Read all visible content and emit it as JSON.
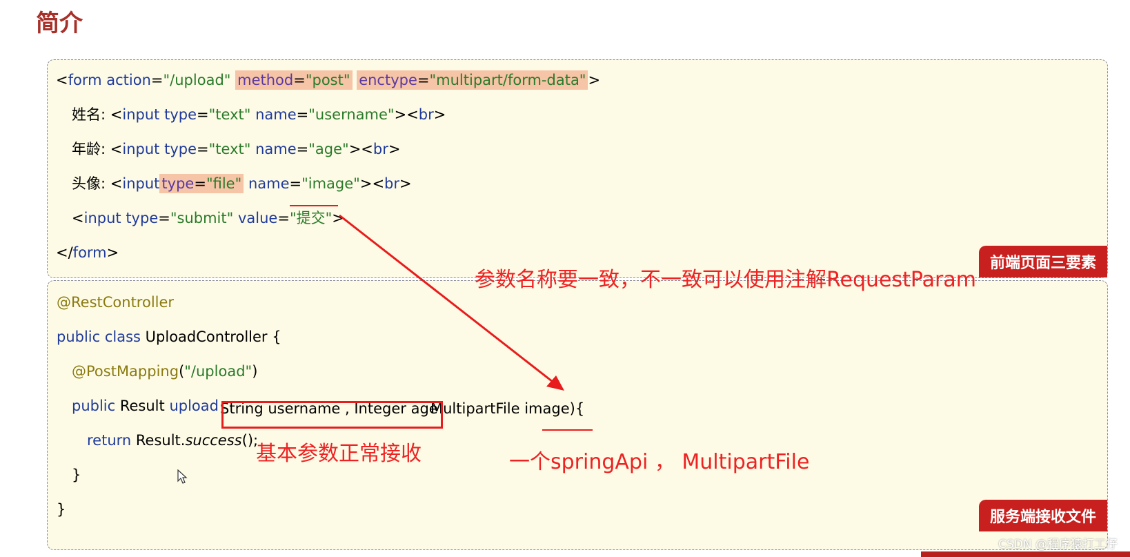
{
  "page": {
    "title": "简介"
  },
  "frontend": {
    "badge": "前端页面三要素",
    "line1": {
      "open": "<",
      "tag": "form",
      "sp1": " ",
      "a1": "action",
      "eq1": "=",
      "v1": "\"/upload\"",
      "sp2": " ",
      "a2": "method",
      "eq2": "=",
      "v2": "\"post\"",
      "sp3": " ",
      "a3": "enctype",
      "eq3": "=",
      "v3": "\"multipart/form-data\"",
      "close": ">"
    },
    "line2": {
      "label": "姓名: ",
      "open": "<",
      "tag": "input",
      "a1": "type",
      "v1": "\"text\"",
      "a2": "name",
      "v2": "\"username\"",
      "tail_open": "><",
      "br": "br",
      "tail_close": ">"
    },
    "line3": {
      "label": "年龄: ",
      "open": "<",
      "tag": "input",
      "a1": "type",
      "v1": "\"text\"",
      "a2": "name",
      "v2": "\"age\"",
      "tail_open": "><",
      "br": "br",
      "tail_close": ">"
    },
    "line4": {
      "label": "头像: ",
      "open": "<",
      "tag": "input",
      "a1": "type",
      "v1": "\"file\"",
      "a2": "name",
      "v2": "\"image\"",
      "tail_open": "><",
      "br": "br",
      "tail_close": ">"
    },
    "line5": {
      "open": "<",
      "tag": "input",
      "a1": "type",
      "v1": "\"submit\"",
      "a2": "value",
      "v2": "\"提交\"",
      "close": ">"
    },
    "line6": {
      "open": "</",
      "tag": "form",
      "close": ">"
    }
  },
  "backend": {
    "badge": "服务端接收文件",
    "l1": "@RestController",
    "l2_kw": "public class",
    "l2_rest": " UploadController {",
    "l3_ann": "@PostMapping",
    "l3_p": "(",
    "l3_str": "\"/upload\"",
    "l3_e": ")",
    "l4_kw": "public",
    "l4_type": " Result ",
    "l4_method": "upload",
    "l4_params": "String username , Integer age",
    "l4_mp": " MultipartFile ",
    "l4_image": "image",
    "l4_end": "){",
    "l5_kw": "return",
    "l5_obj": " Result.",
    "l5_m": "success",
    "l5_end": "();",
    "l6": "}",
    "l7": "}"
  },
  "notes": {
    "param_name": "参数名称要一致，不一致可以使用注解RequestParam",
    "basic_params": "基本参数正常接收",
    "spring_api": "一个springApi ， MultipartFile"
  },
  "watermark": "CSDN @程序猿打工仔",
  "colors": {
    "title": "#a8302a",
    "badge": "#c8201e",
    "note": "#ee2222",
    "box_bg": "#fdfbe6"
  }
}
